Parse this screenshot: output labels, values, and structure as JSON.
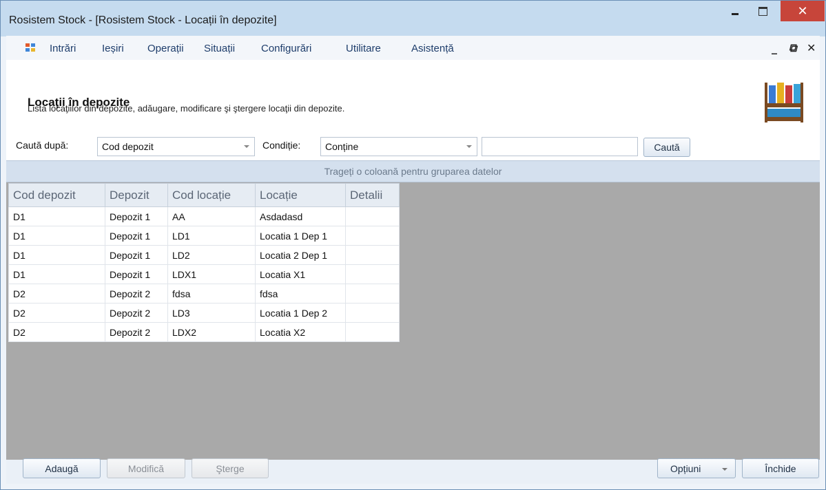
{
  "window": {
    "title": "Rosistem Stock - [Rosistem Stock - Locații în depozite]"
  },
  "menu": {
    "items": [
      "Intrări",
      "Ieșiri",
      "Operații",
      "Situații",
      "Configurări",
      "Utilitare",
      "Asistență"
    ]
  },
  "header": {
    "title": "Locaţii în depozite",
    "description": "Lista locaţiilor din depozite, adăugare, modificare şi ştergere locaţii din depozite."
  },
  "search": {
    "search_by_label": "Caută după:",
    "search_by_value": "Cod depozit",
    "condition_label": "Condiție:",
    "condition_value": "Conține",
    "text_value": "",
    "search_button": "Caută"
  },
  "group_panel": {
    "text": "Trageți o coloană pentru gruparea datelor"
  },
  "grid": {
    "columns": [
      "Cod depozit",
      "Depozit",
      "Cod locație",
      "Locație",
      "Detalii"
    ],
    "rows": [
      [
        "D1",
        "Depozit 1",
        "AA",
        "Asdadasd",
        ""
      ],
      [
        "D1",
        "Depozit 1",
        "LD1",
        "Locatia 1 Dep 1",
        ""
      ],
      [
        "D1",
        "Depozit 1",
        "LD2",
        "Locatia 2 Dep 1",
        ""
      ],
      [
        "D1",
        "Depozit 1",
        "LDX1",
        "Locatia X1",
        ""
      ],
      [
        "D2",
        "Depozit 2",
        "fdsa",
        "fdsa",
        ""
      ],
      [
        "D2",
        "Depozit 2",
        "LD3",
        "Locatia 1 Dep 2",
        ""
      ],
      [
        "D2",
        "Depozit 2",
        "LDX2",
        "Locatia X2",
        ""
      ]
    ]
  },
  "footer": {
    "add": "Adaugă",
    "modify": "Modifică",
    "delete": "Şterge",
    "options": "Opțiuni",
    "close": "Închide"
  },
  "colors": {
    "title_bar": "#c5dbef",
    "close_button": "#c7453a",
    "grid_empty": "#a9a9a9"
  }
}
